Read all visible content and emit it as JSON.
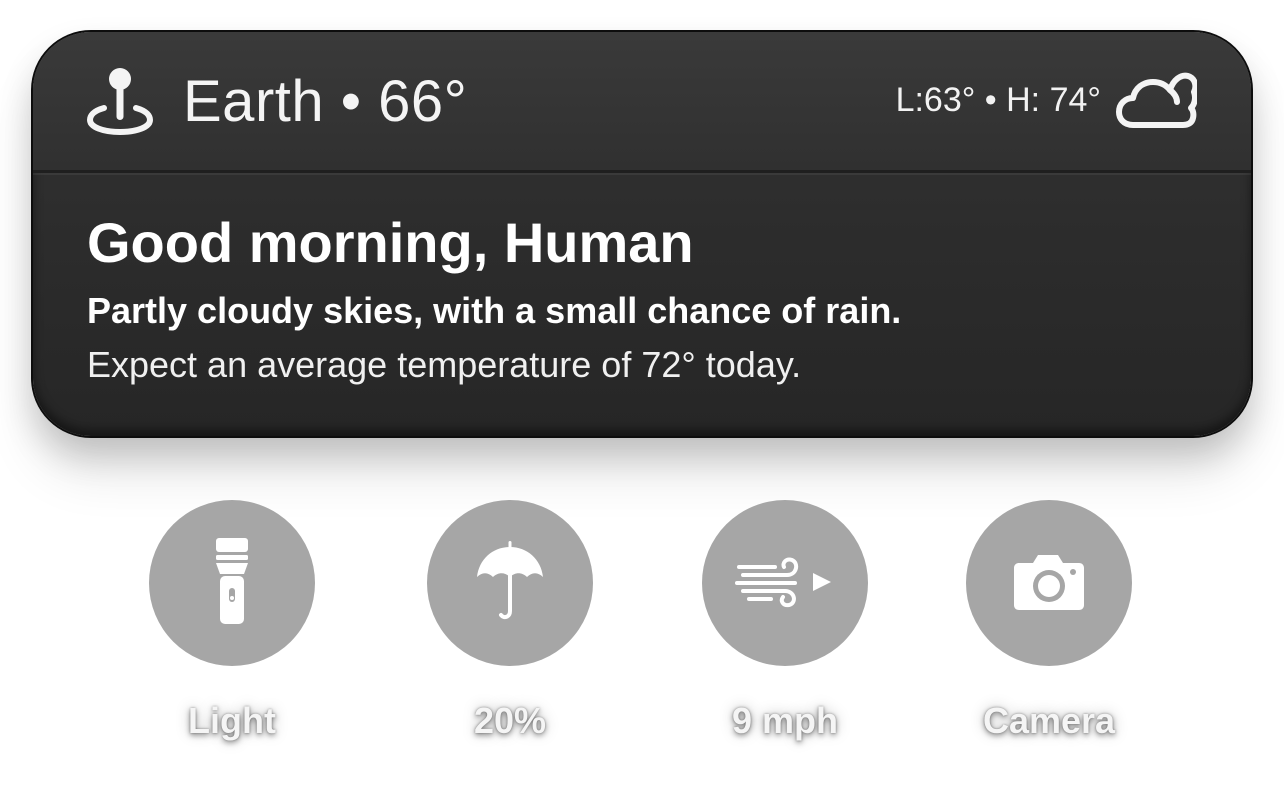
{
  "weather": {
    "location": "Earth",
    "separator": "•",
    "current_temp": "66°",
    "location_temp_text": "Earth • 66°",
    "low_high_text": "L:63° • H: 74°",
    "condition_icon": "cloud-icon",
    "location_icon": "map-pin-icon"
  },
  "message": {
    "greeting": "Good morning, Human",
    "summary": "Partly cloudy skies, with a small chance of rain.",
    "forecast": "Expect an average temperature of 72° today."
  },
  "actions": [
    {
      "label": "Light",
      "icon": "flashlight-icon"
    },
    {
      "label": "20%",
      "icon": "umbrella-icon"
    },
    {
      "label": "9 mph",
      "icon": "wind-icon"
    },
    {
      "label": "Camera",
      "icon": "camera-icon"
    }
  ],
  "colors": {
    "card_background": "#2b2b2b",
    "card_header": "#363636",
    "text_primary": "#ffffff",
    "button_background": "#a6a6a6",
    "page_background": "#ffffff"
  }
}
